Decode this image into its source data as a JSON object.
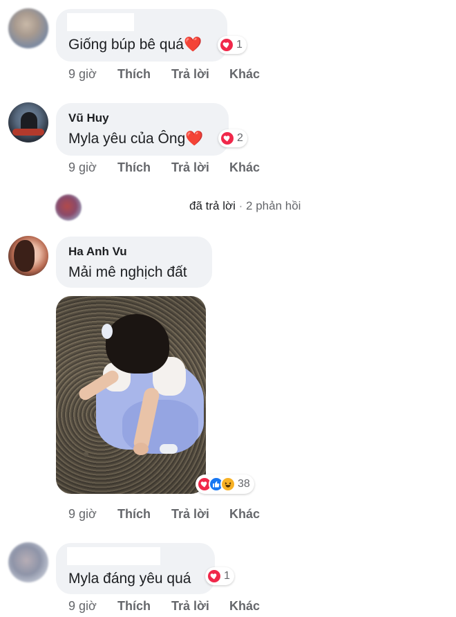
{
  "comments": [
    {
      "author": "",
      "text": "Giống búp bê quá❤️",
      "reaction_count": "1",
      "actions": {
        "time": "9 giờ",
        "like": "Thích",
        "reply": "Trả lời",
        "more": "Khác"
      }
    },
    {
      "author": "Vũ Huy",
      "text": "Myla yêu của Ông❤️",
      "reaction_count": "2",
      "actions": {
        "time": "9 giờ",
        "like": "Thích",
        "reply": "Trả lời",
        "more": "Khác"
      }
    },
    {
      "author": "Ha Anh Vu",
      "text": "Mải mê nghịch đất",
      "reaction_count": "38",
      "actions": {
        "time": "9 giờ",
        "like": "Thích",
        "reply": "Trả lời",
        "more": "Khác"
      }
    },
    {
      "author": "",
      "text": "Myla đáng yêu quá",
      "reaction_count": "1",
      "actions": {
        "time": "9 giờ",
        "like": "Thích",
        "reply": "Trả lời",
        "more": "Khác"
      }
    }
  ],
  "replies_summary": {
    "text": "đã trả lời",
    "separator": "·",
    "count": "2 phản hồi"
  },
  "icons": {
    "love": "heart-icon",
    "like": "thumbs-up-icon",
    "haha": "laughing-face-icon"
  },
  "colors": {
    "bubble": "#f0f2f5",
    "love": "#f0284a",
    "like": "#1877f2",
    "haha": "#f7b125",
    "secondary_text": "#65676b"
  }
}
